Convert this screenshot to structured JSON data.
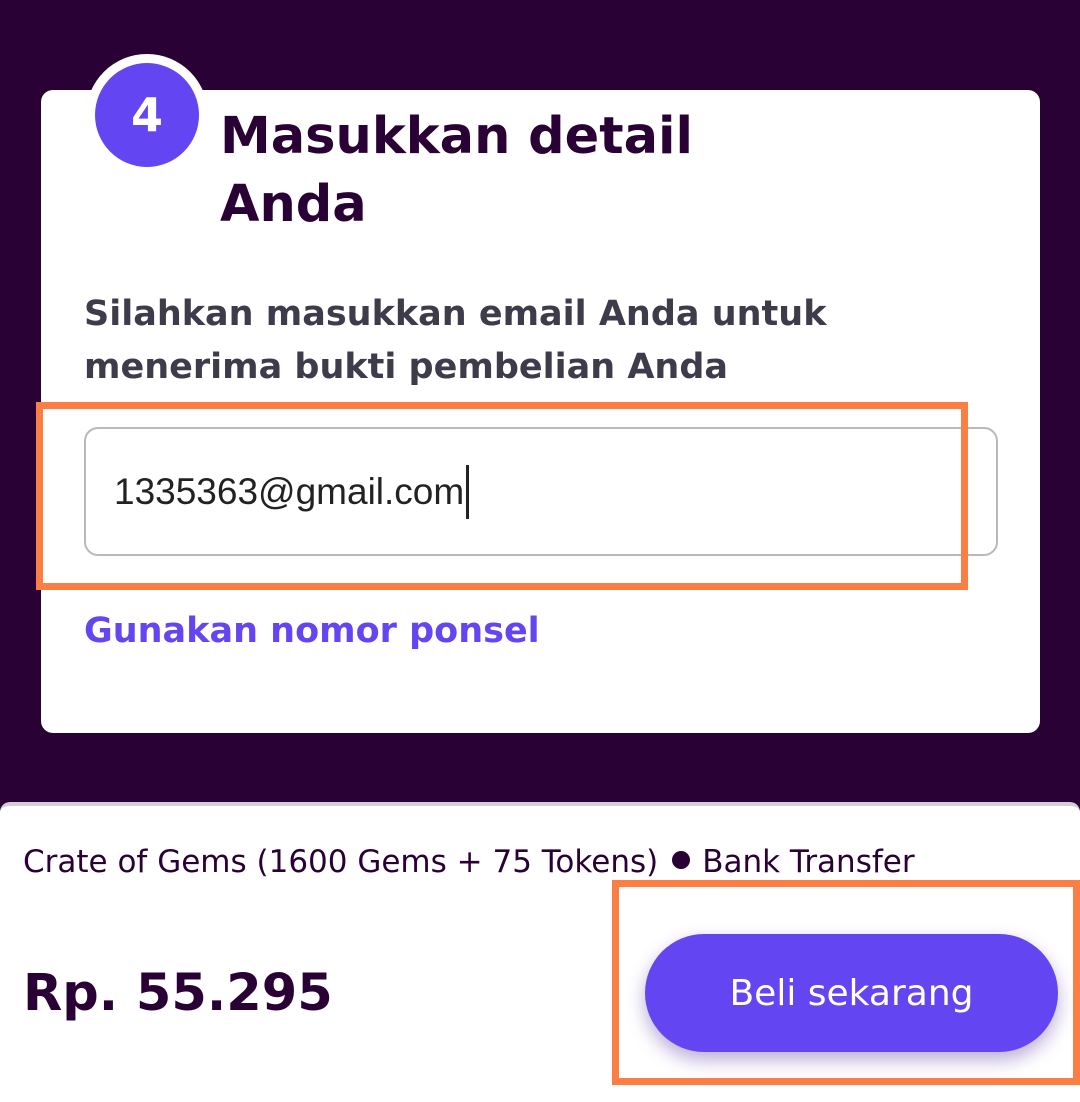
{
  "step": {
    "number": "4",
    "title": "Masukkan detail Anda",
    "description": "Silahkan masukkan email Anda untuk menerima bukti pembelian Anda"
  },
  "email_input": {
    "value": "1335363@gmail.com"
  },
  "phone_link": {
    "label": "Gunakan nomor ponsel"
  },
  "order": {
    "product": "Crate of Gems (1600 Gems + 75 Tokens)",
    "payment_method": "Bank Transfer",
    "price": "Rp. 55.295"
  },
  "buy_button": {
    "label": "Beli sekarang"
  },
  "colors": {
    "background": "#2a0134",
    "accent": "#6445f2",
    "highlight": "#fb7f44"
  }
}
